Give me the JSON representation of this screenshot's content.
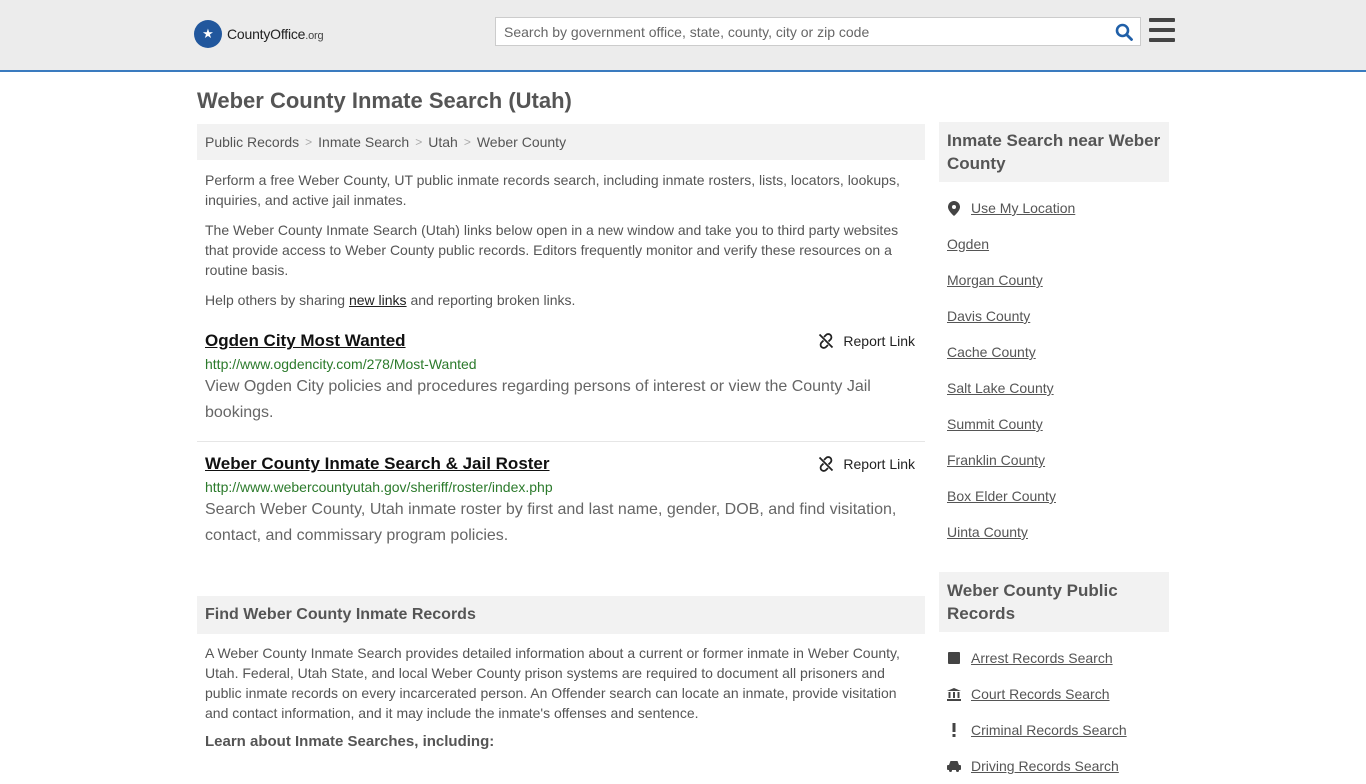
{
  "header": {
    "logo_text": "CountyOffice",
    "logo_tld": ".org",
    "search_placeholder": "Search by government office, state, county, city or zip code"
  },
  "page_title": "Weber County Inmate Search (Utah)",
  "breadcrumb": [
    "Public Records",
    "Inmate Search",
    "Utah",
    "Weber County"
  ],
  "intro": {
    "p1": "Perform a free Weber County, UT public inmate records search, including inmate rosters, lists, locators, lookups, inquiries, and active jail inmates.",
    "p2": "The Weber County Inmate Search (Utah) links below open in a new window and take you to third party websites that provide access to Weber County public records. Editors frequently monitor and verify these resources on a routine basis.",
    "p3_before": "Help others by sharing ",
    "p3_link": "new links",
    "p3_after": " and reporting broken links."
  },
  "results": [
    {
      "title": "Ogden City Most Wanted",
      "url": "http://www.ogdencity.com/278/Most-Wanted",
      "description": "View Ogden City policies and procedures regarding persons of interest or view the County Jail bookings.",
      "report_label": "Report Link"
    },
    {
      "title": "Weber County Inmate Search & Jail Roster",
      "url": "http://www.webercountyutah.gov/sheriff/roster/index.php",
      "description": "Search Weber County, Utah inmate roster by first and last name, gender, DOB, and find visitation, contact, and commissary program policies.",
      "report_label": "Report Link"
    }
  ],
  "find_section": {
    "heading": "Find Weber County Inmate Records",
    "body": "A Weber County Inmate Search provides detailed information about a current or former inmate in Weber County, Utah. Federal, Utah State, and local Weber County prison systems are required to document all prisoners and public inmate records on every incarcerated person. An Offender search can locate an inmate, provide visitation and contact information, and it may include the inmate's offenses and sentence.",
    "learn_heading": "Learn about Inmate Searches, including:"
  },
  "sidebar_nearby": {
    "heading": "Inmate Search near Weber County",
    "use_location": "Use My Location",
    "items": [
      "Ogden",
      "Morgan County",
      "Davis County",
      "Cache County",
      "Salt Lake County",
      "Summit County",
      "Franklin County",
      "Box Elder County",
      "Uinta County"
    ]
  },
  "sidebar_records": {
    "heading": "Weber County Public Records",
    "items": [
      {
        "label": "Arrest Records Search",
        "icon": "square-icon"
      },
      {
        "label": "Court Records Search",
        "icon": "courthouse-icon"
      },
      {
        "label": "Criminal Records Search",
        "icon": "exclamation-icon"
      },
      {
        "label": "Driving Records Search",
        "icon": "car-icon"
      }
    ]
  },
  "colors": {
    "accent": "#3a7bbf",
    "url_green": "#2b7a2b",
    "panel_bg": "#f2f2f2",
    "header_bg": "#ececec"
  }
}
